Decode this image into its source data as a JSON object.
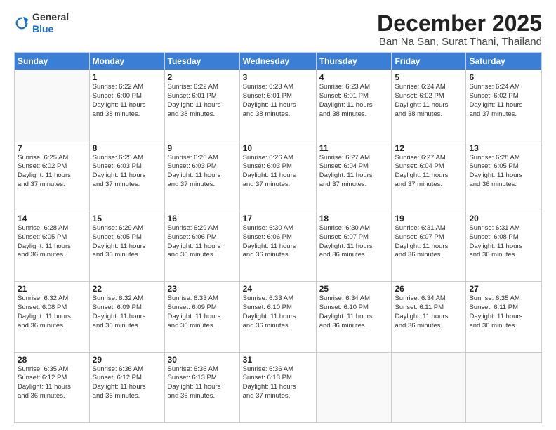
{
  "logo": {
    "general": "General",
    "blue": "Blue"
  },
  "header": {
    "month": "December 2025",
    "location": "Ban Na San, Surat Thani, Thailand"
  },
  "weekdays": [
    "Sunday",
    "Monday",
    "Tuesday",
    "Wednesday",
    "Thursday",
    "Friday",
    "Saturday"
  ],
  "weeks": [
    [
      {
        "day": "",
        "info": ""
      },
      {
        "day": "1",
        "info": "Sunrise: 6:22 AM\nSunset: 6:00 PM\nDaylight: 11 hours\nand 38 minutes."
      },
      {
        "day": "2",
        "info": "Sunrise: 6:22 AM\nSunset: 6:01 PM\nDaylight: 11 hours\nand 38 minutes."
      },
      {
        "day": "3",
        "info": "Sunrise: 6:23 AM\nSunset: 6:01 PM\nDaylight: 11 hours\nand 38 minutes."
      },
      {
        "day": "4",
        "info": "Sunrise: 6:23 AM\nSunset: 6:01 PM\nDaylight: 11 hours\nand 38 minutes."
      },
      {
        "day": "5",
        "info": "Sunrise: 6:24 AM\nSunset: 6:02 PM\nDaylight: 11 hours\nand 38 minutes."
      },
      {
        "day": "6",
        "info": "Sunrise: 6:24 AM\nSunset: 6:02 PM\nDaylight: 11 hours\nand 37 minutes."
      }
    ],
    [
      {
        "day": "7",
        "info": "Sunrise: 6:25 AM\nSunset: 6:02 PM\nDaylight: 11 hours\nand 37 minutes."
      },
      {
        "day": "8",
        "info": "Sunrise: 6:25 AM\nSunset: 6:03 PM\nDaylight: 11 hours\nand 37 minutes."
      },
      {
        "day": "9",
        "info": "Sunrise: 6:26 AM\nSunset: 6:03 PM\nDaylight: 11 hours\nand 37 minutes."
      },
      {
        "day": "10",
        "info": "Sunrise: 6:26 AM\nSunset: 6:03 PM\nDaylight: 11 hours\nand 37 minutes."
      },
      {
        "day": "11",
        "info": "Sunrise: 6:27 AM\nSunset: 6:04 PM\nDaylight: 11 hours\nand 37 minutes."
      },
      {
        "day": "12",
        "info": "Sunrise: 6:27 AM\nSunset: 6:04 PM\nDaylight: 11 hours\nand 37 minutes."
      },
      {
        "day": "13",
        "info": "Sunrise: 6:28 AM\nSunset: 6:05 PM\nDaylight: 11 hours\nand 36 minutes."
      }
    ],
    [
      {
        "day": "14",
        "info": "Sunrise: 6:28 AM\nSunset: 6:05 PM\nDaylight: 11 hours\nand 36 minutes."
      },
      {
        "day": "15",
        "info": "Sunrise: 6:29 AM\nSunset: 6:05 PM\nDaylight: 11 hours\nand 36 minutes."
      },
      {
        "day": "16",
        "info": "Sunrise: 6:29 AM\nSunset: 6:06 PM\nDaylight: 11 hours\nand 36 minutes."
      },
      {
        "day": "17",
        "info": "Sunrise: 6:30 AM\nSunset: 6:06 PM\nDaylight: 11 hours\nand 36 minutes."
      },
      {
        "day": "18",
        "info": "Sunrise: 6:30 AM\nSunset: 6:07 PM\nDaylight: 11 hours\nand 36 minutes."
      },
      {
        "day": "19",
        "info": "Sunrise: 6:31 AM\nSunset: 6:07 PM\nDaylight: 11 hours\nand 36 minutes."
      },
      {
        "day": "20",
        "info": "Sunrise: 6:31 AM\nSunset: 6:08 PM\nDaylight: 11 hours\nand 36 minutes."
      }
    ],
    [
      {
        "day": "21",
        "info": "Sunrise: 6:32 AM\nSunset: 6:08 PM\nDaylight: 11 hours\nand 36 minutes."
      },
      {
        "day": "22",
        "info": "Sunrise: 6:32 AM\nSunset: 6:09 PM\nDaylight: 11 hours\nand 36 minutes."
      },
      {
        "day": "23",
        "info": "Sunrise: 6:33 AM\nSunset: 6:09 PM\nDaylight: 11 hours\nand 36 minutes."
      },
      {
        "day": "24",
        "info": "Sunrise: 6:33 AM\nSunset: 6:10 PM\nDaylight: 11 hours\nand 36 minutes."
      },
      {
        "day": "25",
        "info": "Sunrise: 6:34 AM\nSunset: 6:10 PM\nDaylight: 11 hours\nand 36 minutes."
      },
      {
        "day": "26",
        "info": "Sunrise: 6:34 AM\nSunset: 6:11 PM\nDaylight: 11 hours\nand 36 minutes."
      },
      {
        "day": "27",
        "info": "Sunrise: 6:35 AM\nSunset: 6:11 PM\nDaylight: 11 hours\nand 36 minutes."
      }
    ],
    [
      {
        "day": "28",
        "info": "Sunrise: 6:35 AM\nSunset: 6:12 PM\nDaylight: 11 hours\nand 36 minutes."
      },
      {
        "day": "29",
        "info": "Sunrise: 6:36 AM\nSunset: 6:12 PM\nDaylight: 11 hours\nand 36 minutes."
      },
      {
        "day": "30",
        "info": "Sunrise: 6:36 AM\nSunset: 6:13 PM\nDaylight: 11 hours\nand 36 minutes."
      },
      {
        "day": "31",
        "info": "Sunrise: 6:36 AM\nSunset: 6:13 PM\nDaylight: 11 hours\nand 37 minutes."
      },
      {
        "day": "",
        "info": ""
      },
      {
        "day": "",
        "info": ""
      },
      {
        "day": "",
        "info": ""
      }
    ]
  ]
}
